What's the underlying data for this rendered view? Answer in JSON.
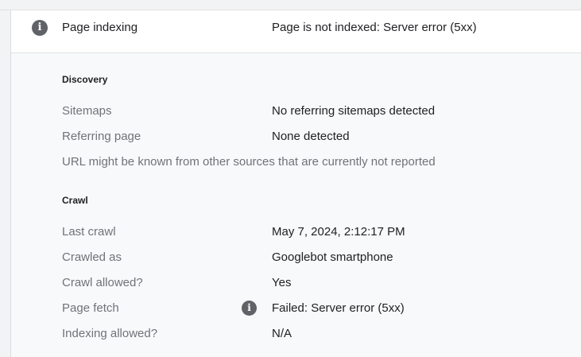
{
  "header": {
    "label": "Page indexing",
    "value": "Page is not indexed: Server error (5xx)"
  },
  "discovery": {
    "section_title": "Discovery",
    "rows": [
      {
        "label": "Sitemaps",
        "value": "No referring sitemaps detected"
      },
      {
        "label": "Referring page",
        "value": "None detected"
      }
    ],
    "note": "URL might be known from other sources that are currently not reported"
  },
  "crawl": {
    "section_title": "Crawl",
    "rows": [
      {
        "label": "Last crawl",
        "value": "May 7, 2024, 2:12:17 PM"
      },
      {
        "label": "Crawled as",
        "value": "Googlebot smartphone"
      },
      {
        "label": "Crawl allowed?",
        "value": "Yes"
      },
      {
        "label": "Page fetch",
        "value": "Failed: Server error (5xx)"
      },
      {
        "label": "Indexing allowed?",
        "value": "N/A"
      }
    ]
  },
  "icons": {
    "header": "info-icon",
    "page_fetch": "info-icon"
  }
}
